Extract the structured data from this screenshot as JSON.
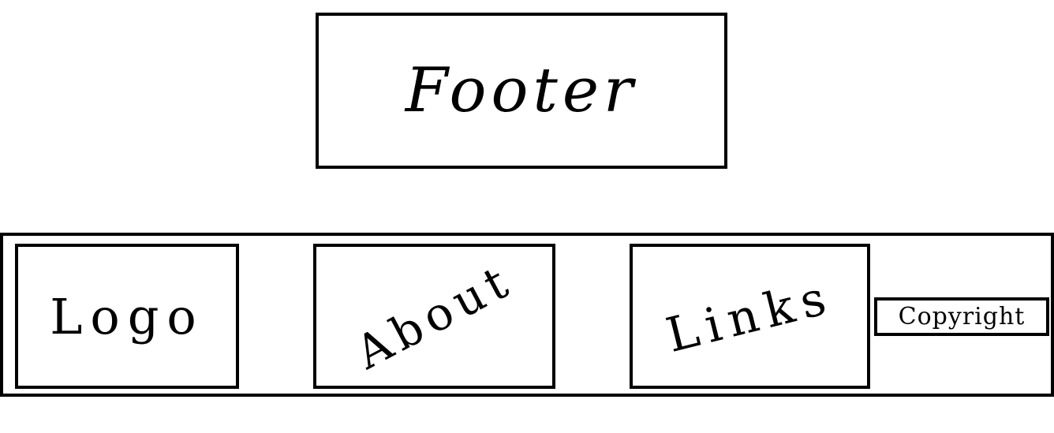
{
  "header": {
    "title": "Footer"
  },
  "footer": {
    "sections": {
      "logo": "Logo",
      "about": "About",
      "links": "Links",
      "copyright": "Copyright"
    }
  }
}
